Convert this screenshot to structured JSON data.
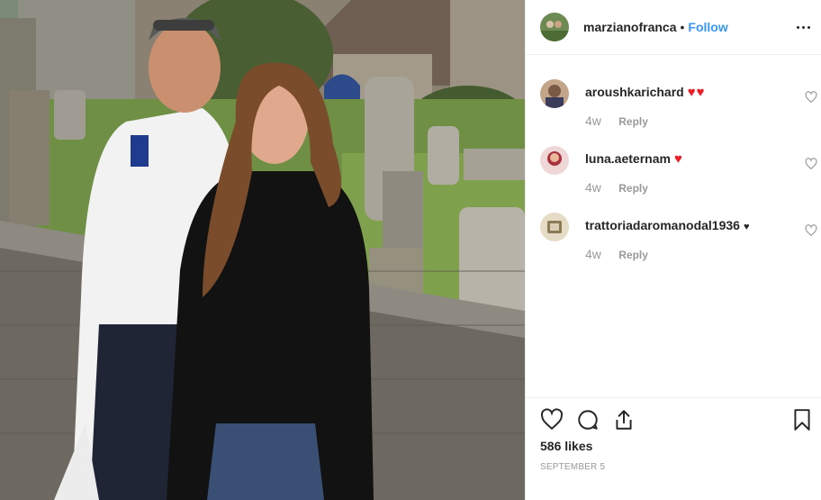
{
  "post": {
    "username": "marzianofranca",
    "separator": "•",
    "follow_label": "Follow",
    "more_icon": "more-options-icon"
  },
  "comments": [
    {
      "username": "aroushkarichard",
      "text": "♥♥",
      "time": "4w",
      "reply_label": "Reply"
    },
    {
      "username": "luna.aeternam",
      "text": "♥",
      "time": "4w",
      "reply_label": "Reply"
    },
    {
      "username": "trattoriadaromanodal1936",
      "text": "♥",
      "time": "4w",
      "reply_label": "Reply"
    }
  ],
  "actions": {
    "like_icon": "heart-icon",
    "comment_icon": "comment-icon",
    "share_icon": "share-icon",
    "save_icon": "bookmark-icon"
  },
  "likes_text": "586 likes",
  "date_text": "SEPTEMBER 5",
  "colors": {
    "follow": "#3897f0",
    "heart_emoji": "#ed1c24",
    "meta": "#999999"
  }
}
